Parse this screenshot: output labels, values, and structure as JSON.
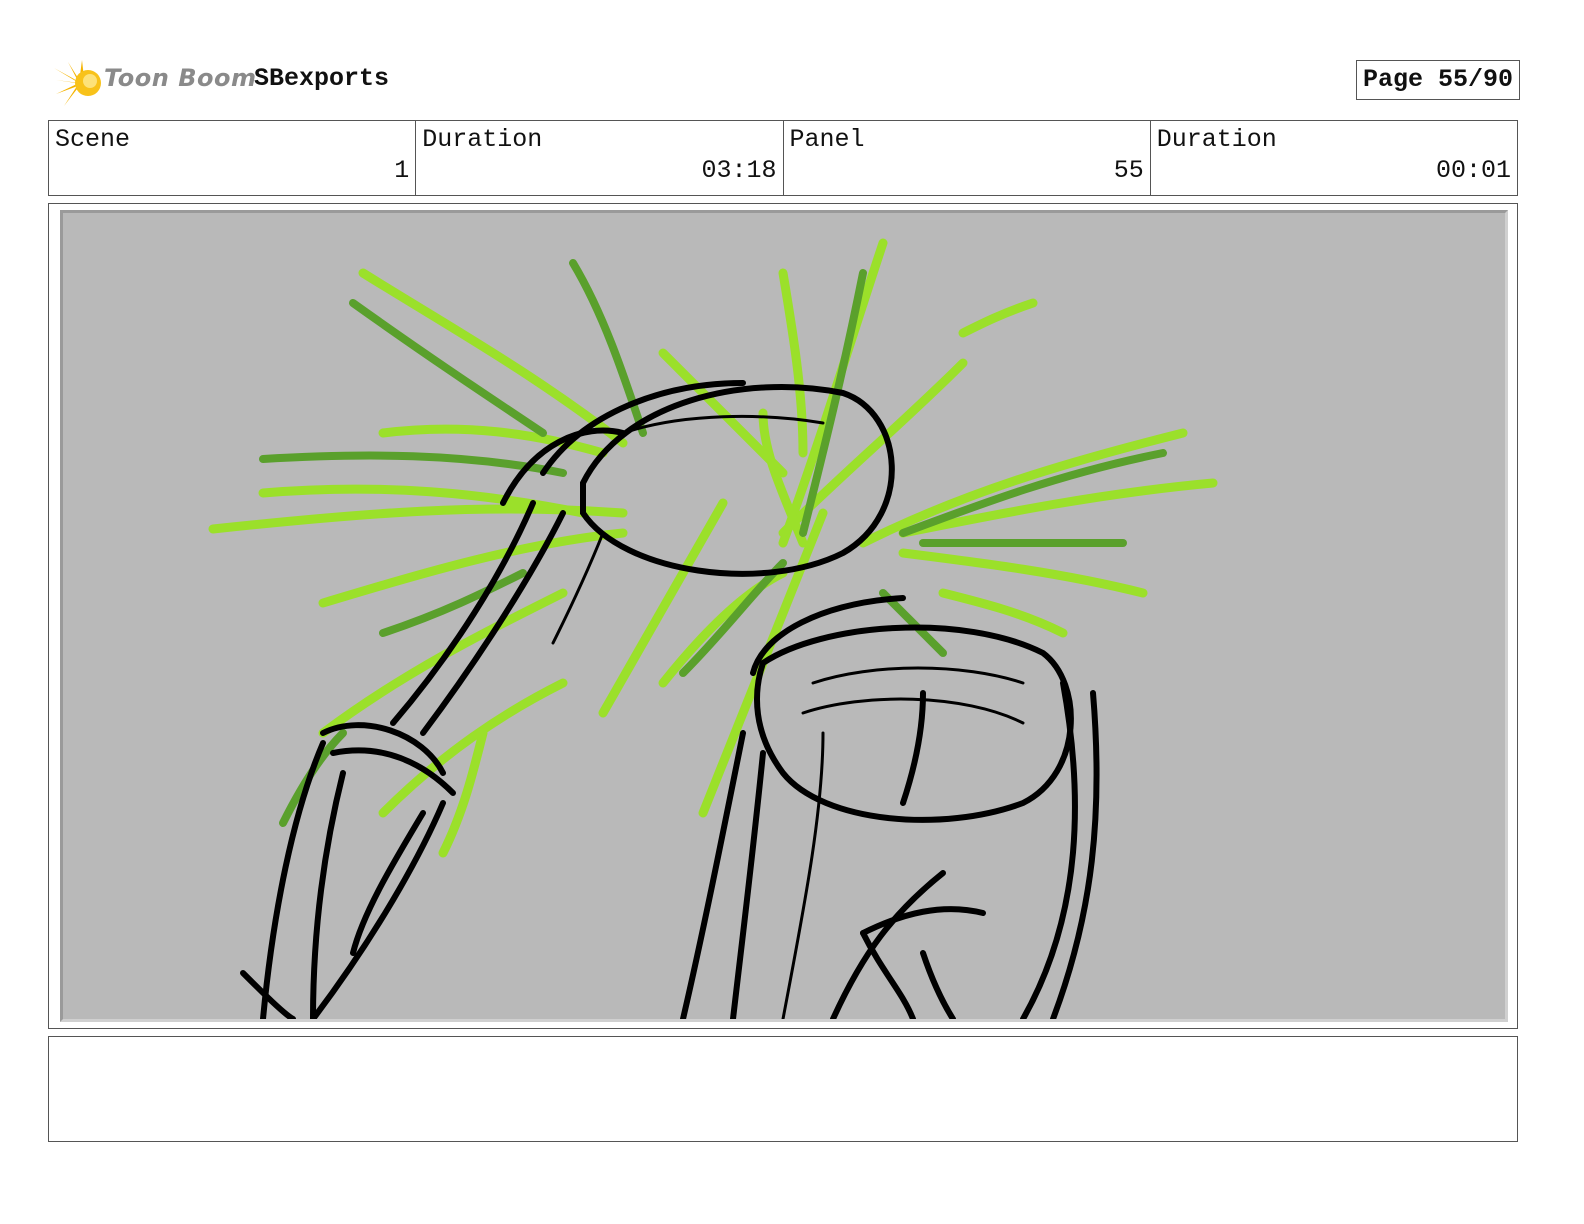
{
  "header": {
    "brand": "Toon Boom",
    "project": "SBexports",
    "page": "Page 55/90"
  },
  "info": {
    "scene_label": "Scene",
    "scene_value": "1",
    "scene_duration_label": "Duration",
    "scene_duration_value": "03:18",
    "panel_label": "Panel",
    "panel_value": "55",
    "panel_duration_label": "Duration",
    "panel_duration_value": "00:01"
  },
  "panel_image": {
    "icon": "storyboard-sketch",
    "background": "#b9b9b9",
    "stroke_colors": [
      "#000000",
      "#9be02a",
      "#5aa02c"
    ]
  },
  "notes": {
    "text": ""
  }
}
